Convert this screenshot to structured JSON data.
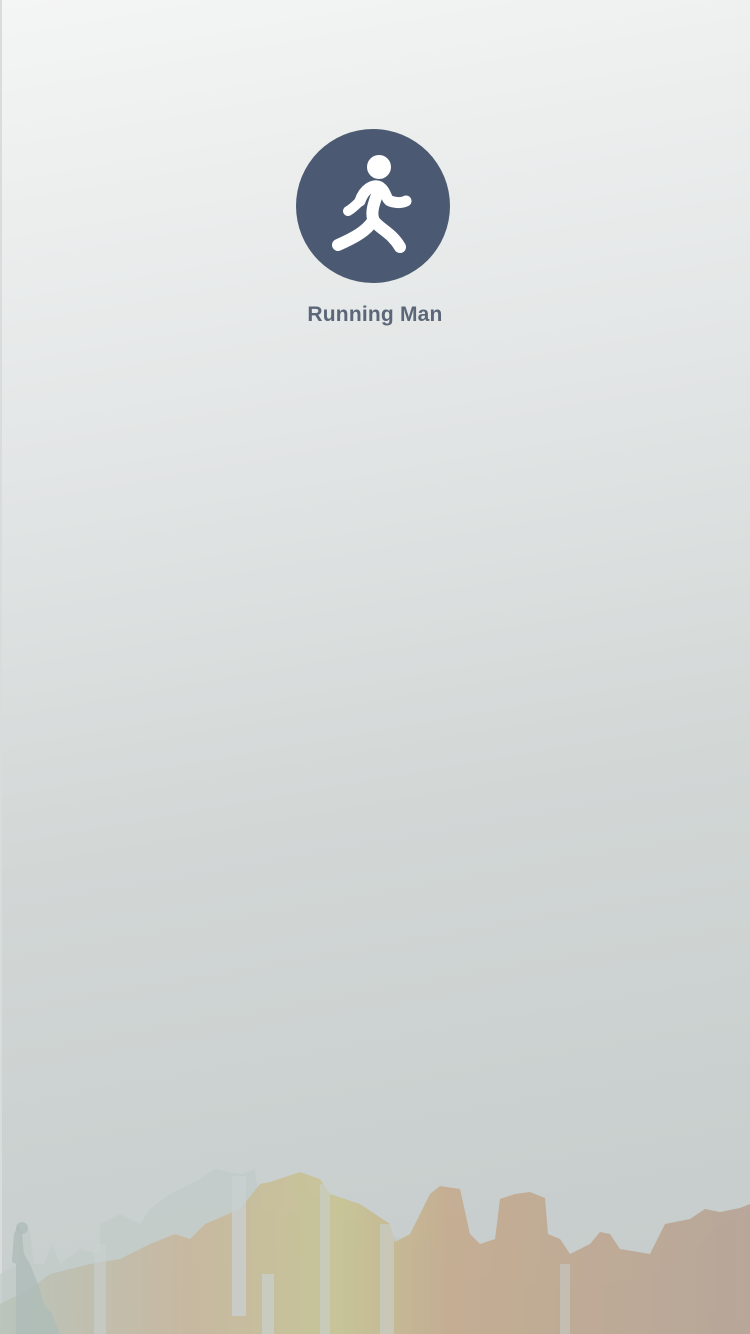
{
  "app": {
    "name": "Running Man",
    "logo_icon": "running-man-icon",
    "brand_color": "#4b5a72"
  },
  "background": {
    "decoration_icon": "city-skyline-illustration"
  }
}
